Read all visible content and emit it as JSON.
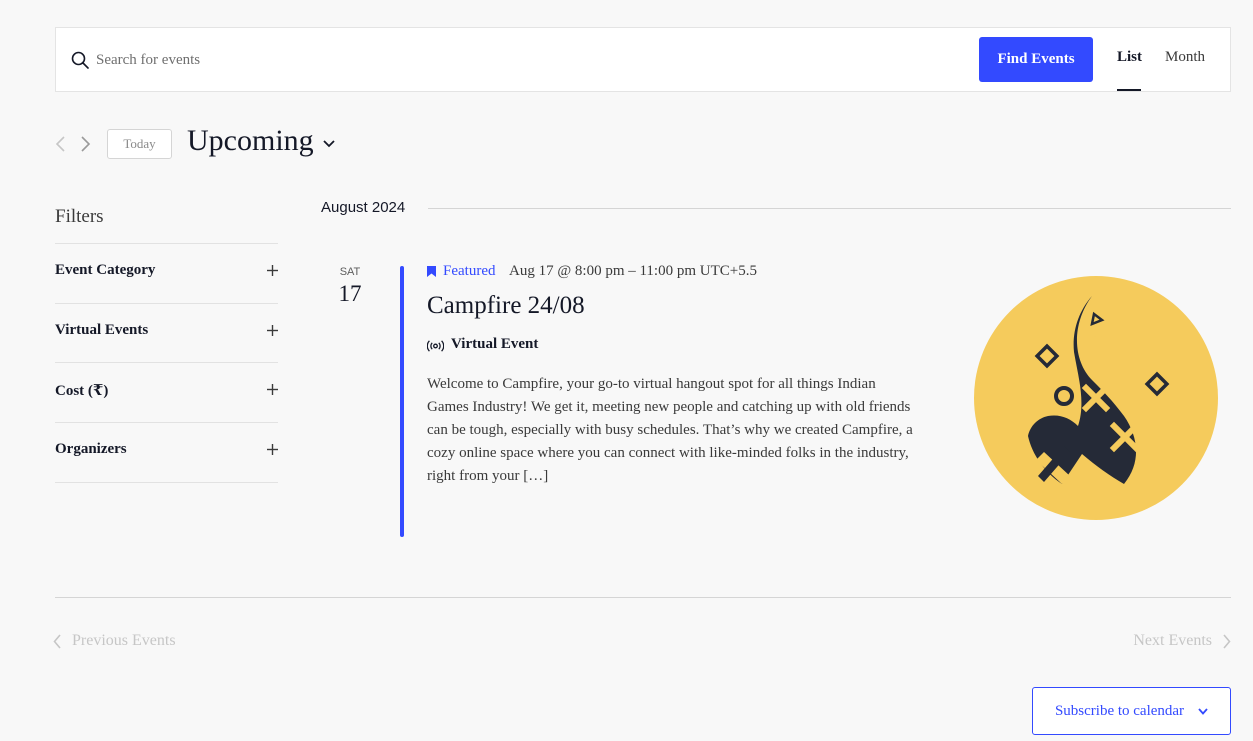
{
  "search": {
    "placeholder": "Search for events",
    "find_button": "Find Events"
  },
  "views": {
    "list": "List",
    "month": "Month",
    "active": "list"
  },
  "nav": {
    "today": "Today",
    "period": "Upcoming"
  },
  "filters": {
    "title": "Filters",
    "items": [
      {
        "label": "Event Category"
      },
      {
        "label": "Virtual Events"
      },
      {
        "label": "Cost (₹)"
      },
      {
        "label": "Organizers"
      }
    ]
  },
  "month_separator": "August 2024",
  "event": {
    "dow": "SAT",
    "day": "17",
    "featured_label": "Featured",
    "time": "Aug 17 @ 8:00 pm – 11:00 pm UTC+5.5",
    "title": "Campfire 24/08",
    "virtual_label": "Virtual Event",
    "description": "Welcome to Campfire, your go-to virtual hangout spot for all things Indian Games Industry! We get it, meeting new people and catching up with old friends can be tough, especially with busy schedules. That’s why we created Campfire, a cozy online space where you can connect with like-minded folks in the industry, right from your […]"
  },
  "pagination": {
    "previous": "Previous Events",
    "next": "Next Events"
  },
  "subscribe": {
    "label": "Subscribe to calendar"
  },
  "colors": {
    "accent": "#334aff",
    "text": "#141827",
    "image_bg": "#f5cb5c",
    "image_fg": "#252a37"
  }
}
